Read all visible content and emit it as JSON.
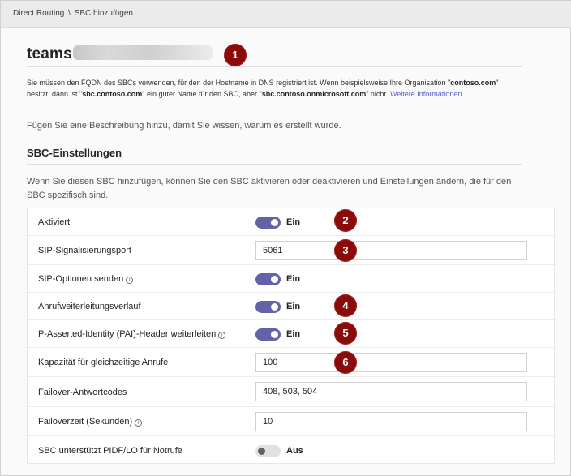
{
  "breadcrumb": {
    "parent": "Direct Routing",
    "separator": "\\",
    "current": "SBC hinzufügen"
  },
  "sbc": {
    "name_prefix": "teams",
    "description_lines": [
      "Sie müssen den FQDN des SBCs verwenden, für den der Hostname in DNS registriert ist. Wenn beispielsweise Ihre Organisation \"",
      "contoso.com",
      "\" besitzt, dann ist \"",
      "sbc.contoso.com",
      "\" ein guter Name für den SBC, aber \"",
      "sbc.contoso.onmicrosoft.com",
      "\" nicht. "
    ],
    "more_info_link": "Weitere Informationen",
    "description_placeholder": "Fügen Sie eine Beschreibung hinzu, damit Sie wissen, warum es erstellt wurde."
  },
  "settings": {
    "title": "SBC-Einstellungen",
    "intro": "Wenn Sie diesen SBC hinzufügen, können Sie den SBC aktivieren oder deaktivieren und Einstellungen ändern, die für den SBC spezifisch sind.",
    "rows": [
      {
        "label": "Aktiviert",
        "type": "toggle",
        "state": "on",
        "state_label": "Ein",
        "info": false
      },
      {
        "label": "SIP-Signalisierungsport",
        "type": "input",
        "value": "5061",
        "info": false
      },
      {
        "label": "SIP-Optionen senden",
        "type": "toggle",
        "state": "on",
        "state_label": "Ein",
        "info": true
      },
      {
        "label": "Anrufweiterleitungsverlauf",
        "type": "toggle",
        "state": "on",
        "state_label": "Ein",
        "info": false
      },
      {
        "label": "P-Asserted-Identity (PAI)-Header weiterleiten",
        "type": "toggle",
        "state": "on",
        "state_label": "Ein",
        "info": true
      },
      {
        "label": "Kapazität für gleichzeitige Anrufe",
        "type": "input",
        "value": "100",
        "info": false
      },
      {
        "label": "Failover-Antwortcodes",
        "type": "input",
        "value": "408, 503, 504",
        "info": false
      },
      {
        "label": "Failoverzeit (Sekunden)",
        "type": "input",
        "value": "10",
        "info": true
      },
      {
        "label": "SBC unterstützt PIDF/LO für Notrufe",
        "type": "toggle",
        "state": "off",
        "state_label": "Aus",
        "info": false
      }
    ]
  },
  "callouts": [
    "1",
    "2",
    "3",
    "4",
    "5",
    "6"
  ],
  "colors": {
    "accent": "#6264a7",
    "callout": "#8b0a0a",
    "link": "#5b5fc7"
  }
}
